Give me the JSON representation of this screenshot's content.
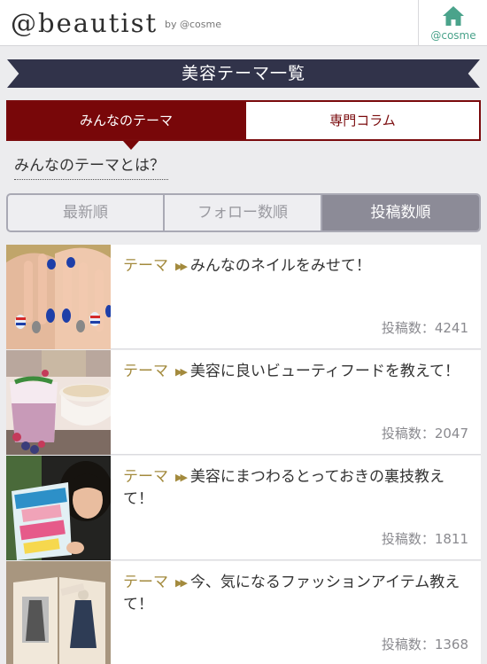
{
  "header": {
    "logo": "@beautist",
    "byline": "by @cosme",
    "home_label": "@cosme"
  },
  "banner": {
    "title": "美容テーマ一覧"
  },
  "theme_tabs": [
    {
      "label": "みんなのテーマ",
      "active": true
    },
    {
      "label": "専門コラム",
      "active": false
    }
  ],
  "about_link": "みんなのテーマとは？",
  "sort_tabs": [
    {
      "label": "最新順",
      "active": false
    },
    {
      "label": "フォロー数順",
      "active": false
    },
    {
      "label": "投稿数順",
      "active": true
    }
  ],
  "items": [
    {
      "tag": "テーマ",
      "title": "みんなのネイルをみせて！",
      "count_text": "投稿数：4241",
      "image": "nail-photo"
    },
    {
      "tag": "テーマ",
      "title": "美容に良いビューティフードを教えて！",
      "count_text": "投稿数：2047",
      "image": "smoothie-photo"
    },
    {
      "tag": "テーマ",
      "title": "美容にまつわるとっておきの裏技教えて！",
      "count_text": "投稿数：1811",
      "image": "magazine-photo"
    },
    {
      "tag": "テーマ",
      "title": "今、気になるファッションアイテム教えて！",
      "count_text": "投稿数：1368",
      "image": "fashion-book-photo"
    }
  ],
  "colors": {
    "accent_red": "#780709",
    "banner_navy": "#31334a",
    "tag_gold": "#a38a3d",
    "home_green": "#4aa38b"
  }
}
